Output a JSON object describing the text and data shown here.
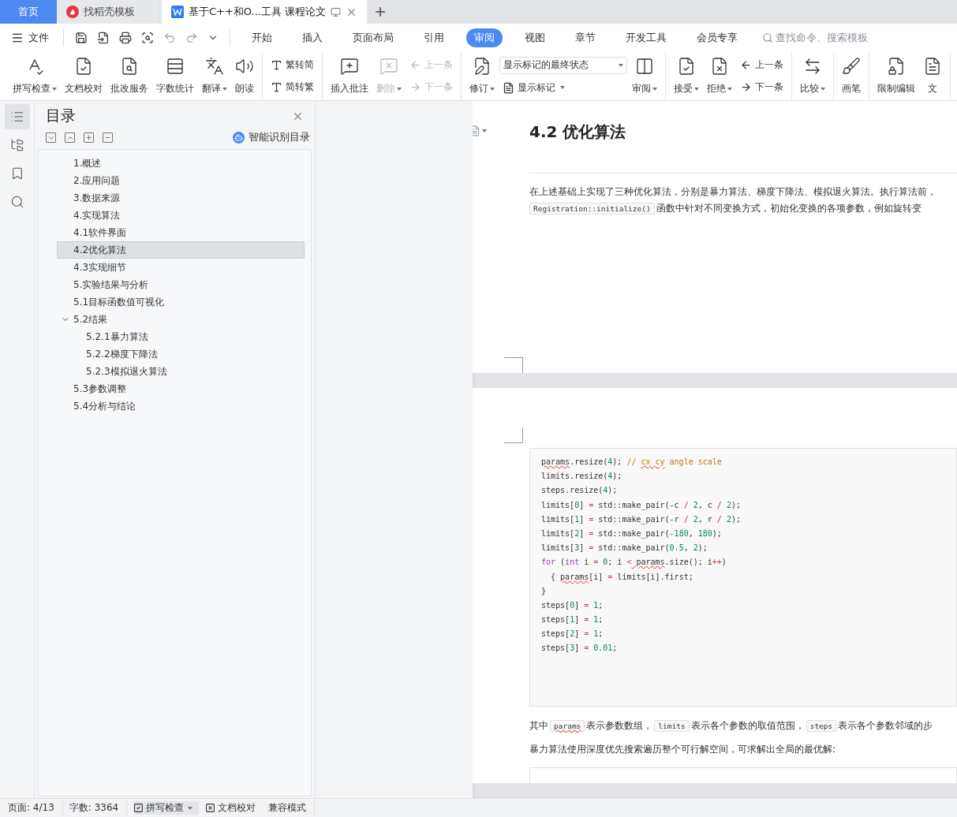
{
  "tabs": [
    {
      "label": "首页",
      "kind": "home",
      "selected": false
    },
    {
      "label": "找稻壳模板",
      "kind": "template",
      "selected": false
    },
    {
      "label": "基于C++和O...工具 课程论文",
      "kind": "doc",
      "selected": true
    }
  ],
  "menu": {
    "file": "文件",
    "tabs": [
      {
        "label": "开始",
        "selected": false
      },
      {
        "label": "插入",
        "selected": false
      },
      {
        "label": "页面布局",
        "selected": false
      },
      {
        "label": "引用",
        "selected": false
      },
      {
        "label": "审阅",
        "selected": true
      },
      {
        "label": "视图",
        "selected": false
      },
      {
        "label": "章节",
        "selected": false
      },
      {
        "label": "开发工具",
        "selected": false
      },
      {
        "label": "会员专享",
        "selected": false
      }
    ],
    "search_placeholder": "查找命令、搜索模板"
  },
  "ribbon": [
    {
      "items": [
        {
          "kind": "large",
          "label": "拼写检查",
          "dropdown": true,
          "disabled": false
        },
        {
          "kind": "large",
          "label": "文档校对",
          "dropdown": false,
          "disabled": false
        },
        {
          "kind": "large",
          "label": "批改服务",
          "dropdown": false,
          "disabled": false
        },
        {
          "kind": "large",
          "label": "字数统计",
          "dropdown": false,
          "disabled": false
        },
        {
          "kind": "large",
          "label": "翻译",
          "dropdown": true,
          "disabled": false
        },
        {
          "kind": "large",
          "label": "朗读",
          "dropdown": false,
          "disabled": false
        }
      ]
    },
    {
      "items": [
        {
          "kind": "stack",
          "entries": [
            {
              "label": "繁转简",
              "dropdown": false,
              "disabled": false
            },
            {
              "label": "简转繁",
              "dropdown": false,
              "disabled": false
            }
          ]
        }
      ]
    },
    {
      "items": [
        {
          "kind": "large",
          "label": "插入批注",
          "dropdown": false,
          "disabled": false
        },
        {
          "kind": "large",
          "label": "删除",
          "dropdown": true,
          "disabled": true
        },
        {
          "kind": "stack",
          "entries": [
            {
              "label": "上一条",
              "dropdown": false,
              "disabled": true
            },
            {
              "label": "下一条",
              "dropdown": false,
              "disabled": true
            }
          ]
        }
      ]
    },
    {
      "items": [
        {
          "kind": "large",
          "label": "修订",
          "dropdown": true,
          "disabled": false
        },
        {
          "kind": "select",
          "value": "显示标记的最终状态",
          "entry": {
            "label": "显示标记",
            "dropdown": true,
            "disabled": false
          }
        },
        {
          "kind": "large",
          "label": "审阅",
          "dropdown": true,
          "disabled": false
        }
      ]
    },
    {
      "items": [
        {
          "kind": "large",
          "label": "接受",
          "dropdown": true,
          "disabled": false
        },
        {
          "kind": "large",
          "label": "拒绝",
          "dropdown": true,
          "disabled": false
        },
        {
          "kind": "stack",
          "entries": [
            {
              "label": "上一条",
              "dropdown": false,
              "disabled": false
            },
            {
              "label": "下一条",
              "dropdown": false,
              "disabled": false
            }
          ]
        }
      ]
    },
    {
      "items": [
        {
          "kind": "large",
          "label": "比较",
          "dropdown": true,
          "disabled": false
        }
      ]
    },
    {
      "items": [
        {
          "kind": "large",
          "label": "画笔",
          "dropdown": false,
          "disabled": false
        }
      ]
    },
    {
      "items": [
        {
          "kind": "large",
          "label": "限制编辑",
          "dropdown": false,
          "disabled": false
        },
        {
          "kind": "large",
          "label": "文",
          "dropdown": false,
          "disabled": false
        }
      ]
    }
  ],
  "rail": [
    {
      "selected": true
    },
    {
      "selected": false
    },
    {
      "selected": false
    },
    {
      "selected": false
    }
  ],
  "toc": {
    "title": "目录",
    "smart_button": "智能识别目录",
    "items": [
      {
        "label": "1.概述",
        "selected": false
      },
      {
        "label": "2.应用问题",
        "selected": false
      },
      {
        "label": "3.数据来源",
        "selected": false
      },
      {
        "label": "4.实现算法",
        "selected": false
      },
      {
        "label": "4.1软件界面",
        "selected": false
      },
      {
        "label": "4.2优化算法",
        "selected": true
      },
      {
        "label": "4.3实现细节",
        "selected": false
      },
      {
        "label": "5.实验结果与分析",
        "selected": false
      },
      {
        "label": "5.1目标函数值可视化",
        "selected": false
      },
      {
        "label": "5.2结果",
        "selected": false,
        "expanded": true,
        "children": [
          {
            "label": "5.2.1暴力算法",
            "selected": false
          },
          {
            "label": "5.2.2梯度下降法",
            "selected": false
          },
          {
            "label": "5.2.3模拟退火算法",
            "selected": false
          }
        ]
      },
      {
        "label": "5.3参数调整",
        "selected": false
      },
      {
        "label": "5.4分析与结论",
        "selected": false
      }
    ]
  },
  "document": {
    "heading": "4.2 优化算法",
    "intro": [
      {
        "text": "在上述基础上实现了三种优化算法，分别是暴力算法、梯度下降法、模拟退火算法。执行算法前，"
      },
      {
        "code": "Registration::initialize()",
        "text": "函数中针对不同变换方式，初始化变换的各项参数，例如旋转变"
      }
    ],
    "code": [
      {
        "tokens": [
          {
            "text": "params",
            "kind": "plain",
            "spell": true
          },
          {
            "text": ".resize(",
            "kind": "plain"
          },
          {
            "text": "4",
            "kind": "num"
          },
          {
            "text": "); ",
            "kind": "plain"
          },
          {
            "text": "// ",
            "kind": "comment"
          },
          {
            "text": "cx",
            "kind": "comment",
            "spell": true
          },
          {
            "text": " cy",
            "kind": "comment",
            "spell": true
          },
          {
            "text": " angle scale",
            "kind": "comment"
          }
        ]
      },
      {
        "tokens": [
          {
            "text": "limits.resize(",
            "kind": "plain"
          },
          {
            "text": "4",
            "kind": "num"
          },
          {
            "text": ");",
            "kind": "plain"
          }
        ]
      },
      {
        "tokens": [
          {
            "text": "steps.resize(",
            "kind": "plain"
          },
          {
            "text": "4",
            "kind": "num"
          },
          {
            "text": ");",
            "kind": "plain"
          }
        ]
      },
      {
        "tokens": [
          {
            "text": "limits[",
            "kind": "plain"
          },
          {
            "text": "0",
            "kind": "num"
          },
          {
            "text": "] ",
            "kind": "plain"
          },
          {
            "text": "=",
            "kind": "op"
          },
          {
            "text": " std::make_pair(-c ",
            "kind": "plain"
          },
          {
            "text": "/",
            "kind": "op"
          },
          {
            "text": " 2",
            "kind": "num"
          },
          {
            "text": ", c ",
            "kind": "plain"
          },
          {
            "text": "/",
            "kind": "op"
          },
          {
            "text": " 2",
            "kind": "num"
          },
          {
            "text": ");",
            "kind": "plain"
          }
        ]
      },
      {
        "tokens": [
          {
            "text": "limits[",
            "kind": "plain"
          },
          {
            "text": "1",
            "kind": "num"
          },
          {
            "text": "] ",
            "kind": "plain"
          },
          {
            "text": "=",
            "kind": "op"
          },
          {
            "text": " std::make_pair(-r ",
            "kind": "plain"
          },
          {
            "text": "/",
            "kind": "op"
          },
          {
            "text": " 2",
            "kind": "num"
          },
          {
            "text": ", r ",
            "kind": "plain"
          },
          {
            "text": "/",
            "kind": "op"
          },
          {
            "text": " 2",
            "kind": "num"
          },
          {
            "text": ");",
            "kind": "plain"
          }
        ]
      },
      {
        "tokens": [
          {
            "text": "limits[",
            "kind": "plain"
          },
          {
            "text": "2",
            "kind": "num"
          },
          {
            "text": "] ",
            "kind": "plain"
          },
          {
            "text": "=",
            "kind": "op"
          },
          {
            "text": " std::make_pair(",
            "kind": "plain"
          },
          {
            "text": "-180",
            "kind": "num"
          },
          {
            "text": ", ",
            "kind": "plain"
          },
          {
            "text": "180",
            "kind": "num"
          },
          {
            "text": ");",
            "kind": "plain"
          }
        ]
      },
      {
        "tokens": [
          {
            "text": "limits[",
            "kind": "plain"
          },
          {
            "text": "3",
            "kind": "num"
          },
          {
            "text": "] ",
            "kind": "plain"
          },
          {
            "text": "=",
            "kind": "op"
          },
          {
            "text": " std::make_pair(",
            "kind": "plain"
          },
          {
            "text": "0.5",
            "kind": "num"
          },
          {
            "text": ", ",
            "kind": "plain"
          },
          {
            "text": "2",
            "kind": "num"
          },
          {
            "text": ");",
            "kind": "plain"
          }
        ]
      },
      {
        "tokens": [
          {
            "text": "for",
            "kind": "kw"
          },
          {
            "text": " (",
            "kind": "plain"
          },
          {
            "text": "int",
            "kind": "kw"
          },
          {
            "text": " i ",
            "kind": "plain"
          },
          {
            "text": "=",
            "kind": "op"
          },
          {
            "text": " 0",
            "kind": "num"
          },
          {
            "text": "; i ",
            "kind": "plain"
          },
          {
            "text": "<",
            "kind": "op"
          },
          {
            "text": " params",
            "kind": "plain",
            "spell": true
          },
          {
            "text": ".size(); i",
            "kind": "plain"
          },
          {
            "text": "++",
            "kind": "op"
          },
          {
            "text": ")",
            "kind": "plain"
          }
        ]
      },
      {
        "tokens": [
          {
            "text": "  { ",
            "kind": "plain"
          },
          {
            "text": "params",
            "kind": "plain",
            "spell": true
          },
          {
            "text": "[i] ",
            "kind": "plain"
          },
          {
            "text": "=",
            "kind": "op"
          },
          {
            "text": " limits[i].first;",
            "kind": "plain"
          }
        ]
      },
      {
        "tokens": [
          {
            "text": "}",
            "kind": "plain"
          }
        ]
      },
      {
        "tokens": [
          {
            "text": "steps[",
            "kind": "plain"
          },
          {
            "text": "0",
            "kind": "num"
          },
          {
            "text": "] ",
            "kind": "plain"
          },
          {
            "text": "=",
            "kind": "op"
          },
          {
            "text": " 1",
            "kind": "num"
          },
          {
            "text": ";",
            "kind": "plain"
          }
        ]
      },
      {
        "tokens": [
          {
            "text": "steps[",
            "kind": "plain"
          },
          {
            "text": "1",
            "kind": "num"
          },
          {
            "text": "] ",
            "kind": "plain"
          },
          {
            "text": "=",
            "kind": "op"
          },
          {
            "text": " 1",
            "kind": "num"
          },
          {
            "text": ";",
            "kind": "plain"
          }
        ]
      },
      {
        "tokens": [
          {
            "text": "steps[",
            "kind": "plain"
          },
          {
            "text": "2",
            "kind": "num"
          },
          {
            "text": "] ",
            "kind": "plain"
          },
          {
            "text": "=",
            "kind": "op"
          },
          {
            "text": " 1",
            "kind": "num"
          },
          {
            "text": ";",
            "kind": "plain"
          }
        ]
      },
      {
        "tokens": [
          {
            "text": "steps[",
            "kind": "plain"
          },
          {
            "text": "3",
            "kind": "num"
          },
          {
            "text": "] ",
            "kind": "plain"
          },
          {
            "text": "=",
            "kind": "op"
          },
          {
            "text": " 0.01",
            "kind": "num"
          },
          {
            "text": ";",
            "kind": "plain"
          }
        ]
      }
    ],
    "after": [
      {
        "kind": "text",
        "text": "其中"
      },
      {
        "kind": "code",
        "text": "params",
        "spell": true
      },
      {
        "kind": "text",
        "text": "表示参数数组，"
      },
      {
        "kind": "code",
        "text": "limits",
        "spell": false
      },
      {
        "kind": "text",
        "text": "表示各个参数的取值范围，"
      },
      {
        "kind": "code",
        "text": "steps",
        "spell": false
      },
      {
        "kind": "text",
        "text": "表示各个参数邻域的步"
      }
    ],
    "closing": "暴力算法使用深度优先搜索遍历整个可行解空间，可求解出全局的最优解:"
  },
  "status": {
    "page": "页面: 4/13",
    "words": "字数: 3364",
    "spell": "拼写检查",
    "proof": "文档校对",
    "mode": "兼容模式"
  }
}
